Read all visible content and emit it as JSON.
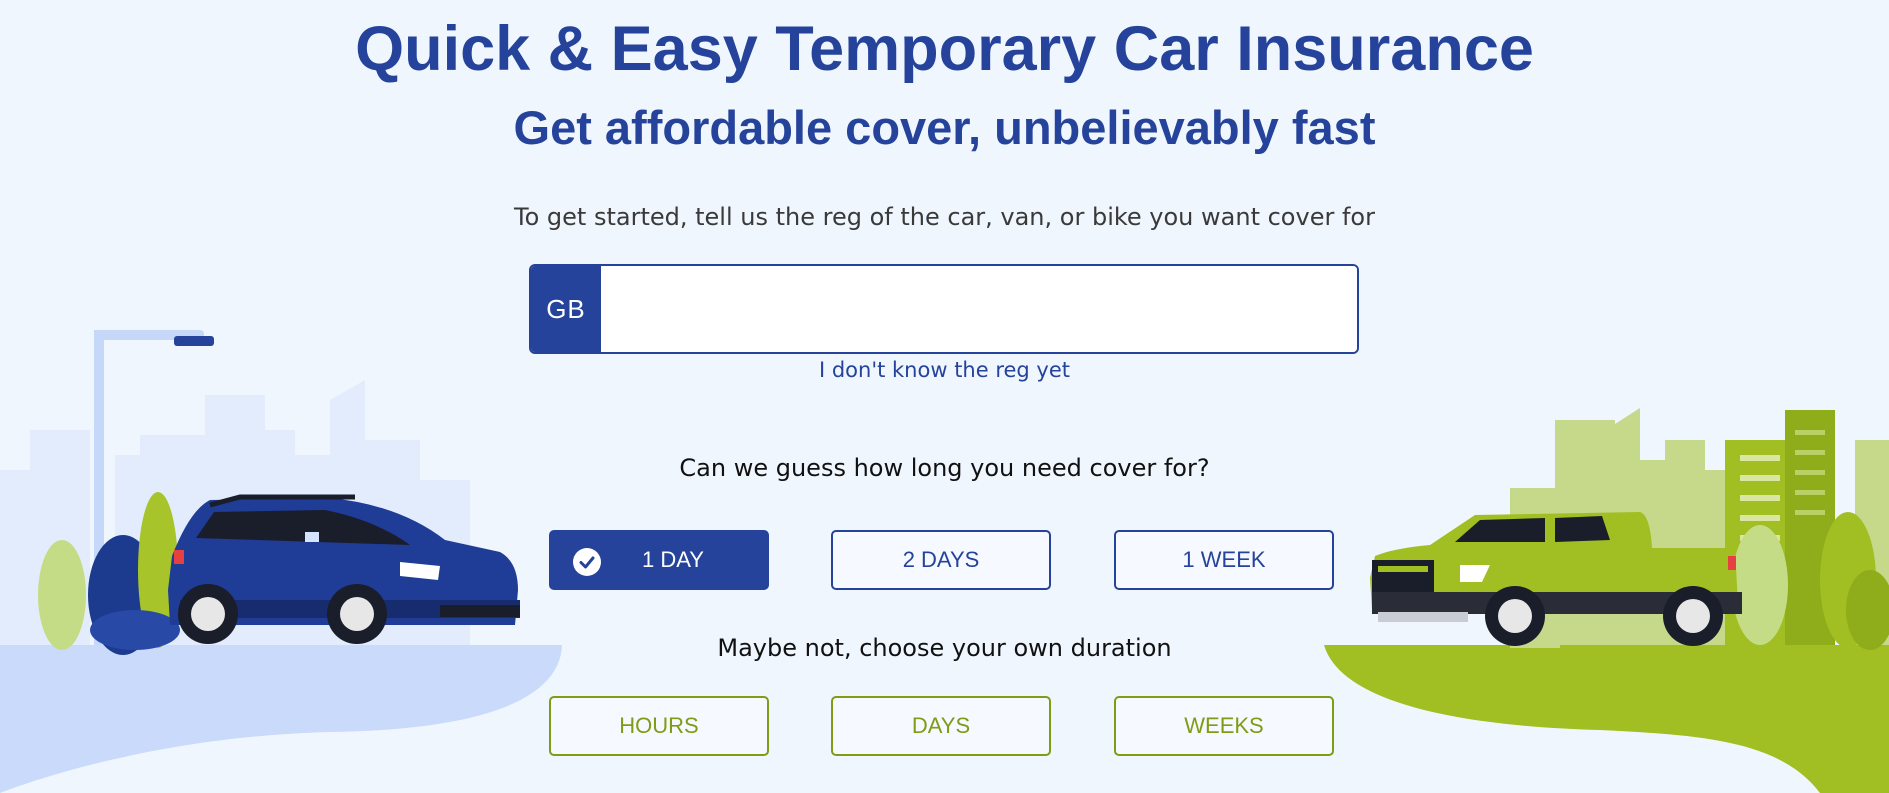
{
  "header": {
    "title": "Quick & Easy Temporary Car Insurance",
    "subtitle": "Get affordable cover, unbelievably fast"
  },
  "registration": {
    "prompt": "To get started, tell us the reg of the car, van, or bike you want cover for",
    "country_code": "GB",
    "value": "",
    "placeholder": "",
    "unknown_reg_link": "I don't know the reg yet"
  },
  "duration_guess": {
    "question": "Can we guess how long you need cover for?",
    "options": [
      {
        "label": "1 DAY",
        "selected": true
      },
      {
        "label": "2 DAYS",
        "selected": false
      },
      {
        "label": "1 WEEK",
        "selected": false
      }
    ]
  },
  "duration_custom": {
    "heading": "Maybe not, choose your own duration",
    "options": [
      {
        "label": "HOURS"
      },
      {
        "label": "DAYS"
      },
      {
        "label": "WEEKS"
      }
    ]
  },
  "colors": {
    "brand_blue": "#25439a",
    "accent_green": "#7f9c14",
    "background": "#f0f6fe"
  },
  "icons": [
    "check-circle-icon",
    "street-lamp-icon",
    "blue-suv-icon",
    "green-pickup-truck-icon"
  ]
}
